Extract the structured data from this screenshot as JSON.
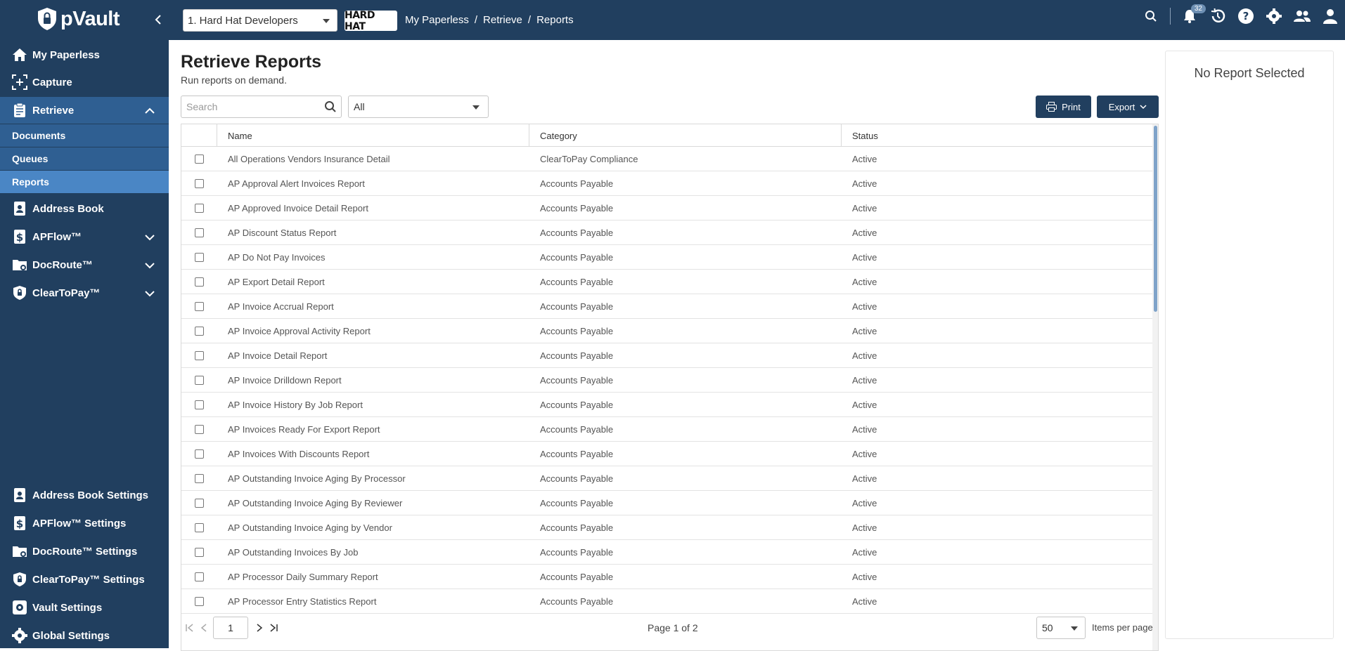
{
  "app": {
    "logo_text": "pVault",
    "vault_selector": "1. Hard Hat Developers",
    "company_logo_text": "HARD HAT",
    "breadcrumb": [
      "My Paperless",
      "Retrieve",
      "Reports"
    ],
    "notification_count": "32"
  },
  "sidebar": {
    "items": [
      {
        "label": "My Paperless",
        "icon": "home-icon"
      },
      {
        "label": "Capture",
        "icon": "capture-icon"
      },
      {
        "label": "Retrieve",
        "icon": "clipboard-icon"
      },
      {
        "label": "Address Book",
        "icon": "address-book-icon"
      },
      {
        "label": "APFlow™",
        "icon": "dollar-doc-icon"
      },
      {
        "label": "DocRoute™",
        "icon": "folder-route-icon"
      },
      {
        "label": "ClearToPay™",
        "icon": "shield-lock-icon"
      }
    ],
    "retrieve_sub": [
      "Documents",
      "Queues",
      "Reports"
    ],
    "settings": [
      {
        "label": "Address Book Settings"
      },
      {
        "label": "APFlow™ Settings"
      },
      {
        "label": "DocRoute™ Settings"
      },
      {
        "label": "ClearToPay™ Settings"
      },
      {
        "label": "Vault Settings"
      },
      {
        "label": "Global Settings"
      }
    ]
  },
  "main": {
    "title": "Retrieve Reports",
    "subtitle": "Run reports on demand.",
    "search_placeholder": "Search",
    "filter_value": "All",
    "print_label": "Print",
    "export_label": "Export",
    "columns": {
      "name": "Name",
      "category": "Category",
      "status": "Status"
    },
    "rows": [
      {
        "name": "All Operations Vendors Insurance Detail",
        "category": "ClearToPay Compliance",
        "status": "Active"
      },
      {
        "name": "AP Approval Alert Invoices Report",
        "category": "Accounts Payable",
        "status": "Active"
      },
      {
        "name": "AP Approved Invoice Detail Report",
        "category": "Accounts Payable",
        "status": "Active"
      },
      {
        "name": "AP Discount Status Report",
        "category": "Accounts Payable",
        "status": "Active"
      },
      {
        "name": "AP Do Not Pay Invoices",
        "category": "Accounts Payable",
        "status": "Active"
      },
      {
        "name": "AP Export Detail Report",
        "category": "Accounts Payable",
        "status": "Active"
      },
      {
        "name": "AP Invoice Accrual Report",
        "category": "Accounts Payable",
        "status": "Active"
      },
      {
        "name": "AP Invoice Approval Activity Report",
        "category": "Accounts Payable",
        "status": "Active"
      },
      {
        "name": "AP Invoice Detail Report",
        "category": "Accounts Payable",
        "status": "Active"
      },
      {
        "name": "AP Invoice Drilldown Report",
        "category": "Accounts Payable",
        "status": "Active"
      },
      {
        "name": "AP Invoice History By Job Report",
        "category": "Accounts Payable",
        "status": "Active"
      },
      {
        "name": "AP Invoices Ready For Export Report",
        "category": "Accounts Payable",
        "status": "Active"
      },
      {
        "name": "AP Invoices With Discounts Report",
        "category": "Accounts Payable",
        "status": "Active"
      },
      {
        "name": "AP Outstanding Invoice Aging By Processor",
        "category": "Accounts Payable",
        "status": "Active"
      },
      {
        "name": "AP Outstanding Invoice Aging By Reviewer",
        "category": "Accounts Payable",
        "status": "Active"
      },
      {
        "name": "AP Outstanding Invoice Aging by Vendor",
        "category": "Accounts Payable",
        "status": "Active"
      },
      {
        "name": "AP Outstanding Invoices By Job",
        "category": "Accounts Payable",
        "status": "Active"
      },
      {
        "name": "AP Processor Daily Summary Report",
        "category": "Accounts Payable",
        "status": "Active"
      },
      {
        "name": "AP Processor Entry Statistics Report",
        "category": "Accounts Payable",
        "status": "Active"
      }
    ],
    "pager": {
      "page_input": "1",
      "page_label": "Page 1 of 2",
      "per_page": "50",
      "per_page_label": "Items per page"
    }
  },
  "right_panel": {
    "title": "No Report Selected"
  }
}
